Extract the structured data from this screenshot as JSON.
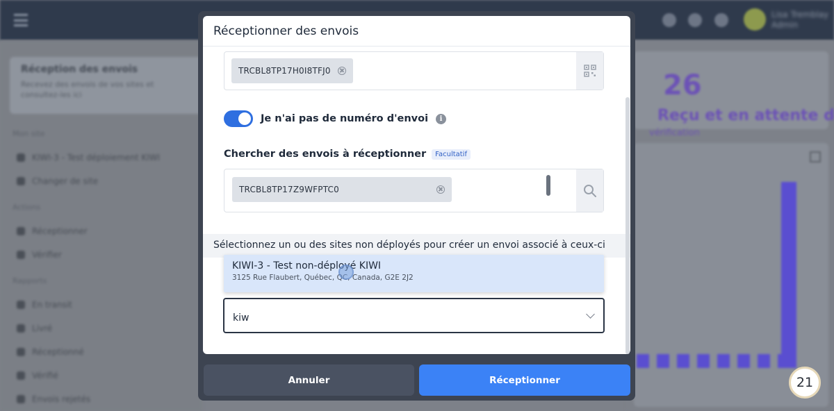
{
  "background": {
    "user_name": "Lisa Tremblay",
    "user_role": "Admin",
    "sidebar": {
      "card_title": "Réception des envois",
      "card_text": "Recevez des envois de vos sites et consultez-les ici",
      "section_sites": "Mon site",
      "site_item": "KIWI-3 - Test déploiement KIWI",
      "change_site": "Changer de site",
      "section_actions": "Actions",
      "actions": [
        "Réceptionner",
        "Vérifier"
      ],
      "section_reports": "Rapports",
      "reports": [
        "En transit",
        "Livré",
        "Réceptionné",
        "Vérifié",
        "Envois rejetés"
      ]
    },
    "stat_number": "26",
    "stat_text": "Reçu et en attente de",
    "stat_subtext": "vérification"
  },
  "modal": {
    "title": "Réceptionner des envois",
    "shipment_chip": "TRCBL8TP17H0I8TFJ0",
    "toggle_label": "Je n'ai pas de numéro d'envoi",
    "toggle_on": true,
    "search_label": "Chercher des envois à réceptionner",
    "optional_badge": "Facultatif",
    "search_chip": "TRCBL8TP17Z9WFPTC0",
    "sites_instruction": "Sélectionnez un ou des sites non déployés pour créer un envoi associé à ceux-ci",
    "dropdown_option": {
      "name": "KIWI-3 - Test non-déployé KIWI",
      "address": "3125 Rue Flaubert, Québec, QC, Canada, G2E 2J2"
    },
    "select_value": "kiw",
    "cancel_label": "Annuler",
    "submit_label": "Réceptionner"
  },
  "page_number": "21",
  "colors": {
    "primary": "#3b82f6",
    "toggle": "#2f6fe0",
    "cancel": "#4a5262",
    "highlight": "#d9e6fa",
    "stat_purple": "#6c52b6"
  }
}
